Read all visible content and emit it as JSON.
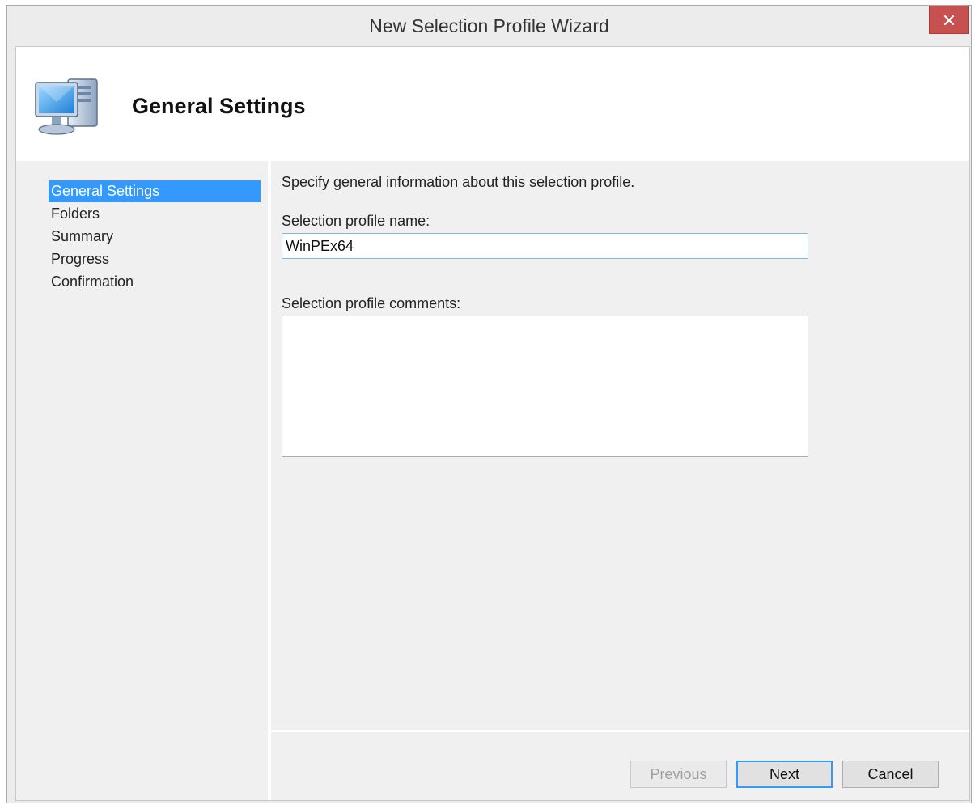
{
  "window": {
    "title": "New Selection Profile Wizard",
    "close_glyph": "✕"
  },
  "header": {
    "icon": "computer-icon",
    "title": "General Settings"
  },
  "nav": {
    "items": [
      {
        "label": "General Settings",
        "selected": true
      },
      {
        "label": "Folders",
        "selected": false
      },
      {
        "label": "Summary",
        "selected": false
      },
      {
        "label": "Progress",
        "selected": false
      },
      {
        "label": "Confirmation",
        "selected": false
      }
    ]
  },
  "form": {
    "intro": "Specify general information about this selection profile.",
    "name_label": "Selection profile name:",
    "name_value": "WinPEx64",
    "comments_label": "Selection profile comments:",
    "comments_value": ""
  },
  "buttons": {
    "previous": "Previous",
    "next": "Next",
    "cancel": "Cancel"
  },
  "colors": {
    "selection": "#3399ff",
    "close": "#c75050",
    "focus_border": "#7eb4ea"
  }
}
